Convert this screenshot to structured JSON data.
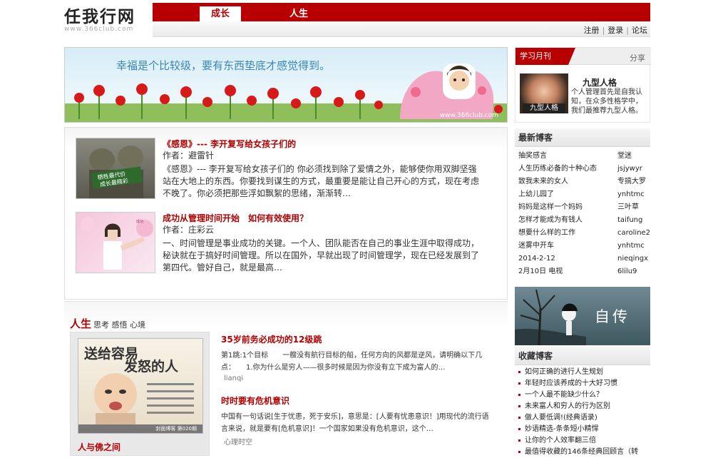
{
  "logo": {
    "title": "任我行网",
    "url": "www.366club.com"
  },
  "nav": {
    "tab_active": "成长",
    "tab_2": "人生"
  },
  "userlinks": {
    "register": "注册",
    "login": "登录",
    "forum": "论坛"
  },
  "banner": {
    "text": "幸福是个比较级，要有东西垫底才感觉得到。",
    "watermark": "www.366club.com"
  },
  "articles": [
    {
      "title": "《感恩》--- 李开复写给女孩子们的",
      "author": "作者：避雷针",
      "summary": "《感恩》--- 李开复写给女孩子们的 你必须找到除了爱情之外，能够使你用双脚坚强站在大地上的东西。你要找到谋生的方式，最重要是能让自己开心的方式，现在考虑不晚了。你必须把那些浮如飘絮的思绪，渐渐转…"
    },
    {
      "title": "成功从管理时间开始　如何有效使用？",
      "author": "作者：庄彩云",
      "summary": "一、时间管理是事业成功的关键。一个人、团队能否在自己的事业生涯中取得成功，秘诀就在于搞好时间管理。所以在国外，早就出现了时间管理学，现在已经发展到了第四代。管好自己，就是最高…"
    }
  ],
  "life": {
    "title": "人生",
    "subtitle": "思考 感悟 心境",
    "book_line1": "送给容易",
    "book_line2": "发怒的人",
    "book_foot": "封面博客 第020期",
    "book_caption": "人与佛之间",
    "items": [
      {
        "title": "35岁前务必成功的12级跳",
        "desc": "第1跳:1个目标　　一艘没有航行目标的船，任何方向的风都是逆风，请明确以下几点：　　1.你为什么是穷人——很多时候是因为你没有立下成为富人的…",
        "author": "lianqi"
      },
      {
        "title": "时时要有危机意识",
        "desc": "中国有一句话说[生于忧患，死于安乐]，意思是：[人要有忧患意识！]用现代的流行语言来说，就是要有[危机意识]！一个国家如果没有危机意识，这个…",
        "author": "心理时空"
      }
    ]
  },
  "study": {
    "tab": "学习月刊",
    "share": "分享",
    "pic_label": "九型人格",
    "name": "九型人格",
    "desc": "个人管理首先是自我认知，在众多性格学中，我们最推荐九型人格。"
  },
  "newest": {
    "heading": "最新博客",
    "rows": [
      {
        "t": "抽奖感言",
        "a": "堂迷"
      },
      {
        "t": "人生历练必备的十种心态",
        "a": "jsjywyr"
      },
      {
        "t": "致我未来的女人",
        "a": "专搞大罗"
      },
      {
        "t": "上幼儿园了",
        "a": "ynhtmc"
      },
      {
        "t": "妈妈是这样一个妈妈",
        "a": "三叶草"
      },
      {
        "t": "怎样才能成为有钱人",
        "a": "taifung"
      },
      {
        "t": "想要什么样的工作",
        "a": "caroline2"
      },
      {
        "t": "迷雾中开车",
        "a": "ynhtmc"
      },
      {
        "t": "2014-2-12",
        "a": "nieqingx"
      },
      {
        "t": "2月10日 电视",
        "a": "6lilu9"
      }
    ]
  },
  "zizhuan": {
    "text": "自传"
  },
  "favorites": {
    "heading": "收藏博客",
    "rows": [
      "如何正确的进行人生规划",
      "年轻时应该养成的十大好习惯",
      "一个人最不能缺少什么？",
      "未来富人和穷人的行为区别",
      "做人要低调!(经典语录)",
      "妙语精选-条条短小精悍",
      "让你的个人效率翻三倍",
      "最值得收藏的146条经典回顾言（转"
    ]
  },
  "colors": {
    "brand": "#b80000",
    "link_title": "#b00000"
  }
}
